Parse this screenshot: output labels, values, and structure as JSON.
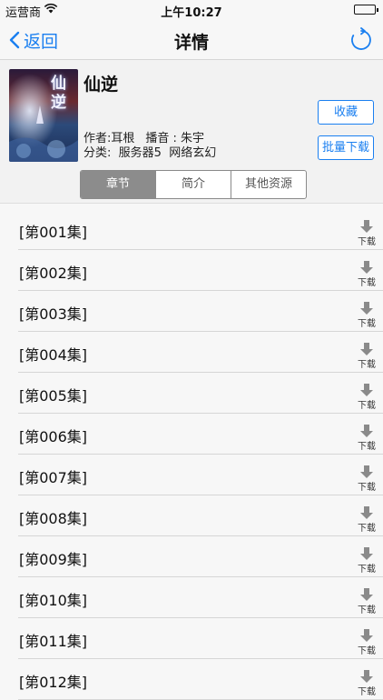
{
  "status_bar": {
    "carrier": "运营商",
    "time": "上午10:27"
  },
  "nav": {
    "back_label": "返回",
    "title": "详情"
  },
  "book": {
    "title": "仙逆",
    "author_line": "作者:耳根",
    "narrator_line": "播音 : 朱宇",
    "category_line": "分类:",
    "server": "服务器5",
    "genre": "网络玄幻",
    "cover_text": "仙逆"
  },
  "actions": {
    "favorite_label": "收藏",
    "batch_download_label": "批量下载"
  },
  "tabs": [
    {
      "label": "章节",
      "active": true
    },
    {
      "label": "简介",
      "active": false
    },
    {
      "label": "其他资源",
      "active": false
    }
  ],
  "chapters": [
    {
      "title": "[第001集]",
      "download_label": "下载"
    },
    {
      "title": "[第002集]",
      "download_label": "下载"
    },
    {
      "title": "[第003集]",
      "download_label": "下载"
    },
    {
      "title": "[第004集]",
      "download_label": "下载"
    },
    {
      "title": "[第005集]",
      "download_label": "下载"
    },
    {
      "title": "[第006集]",
      "download_label": "下载"
    },
    {
      "title": "[第007集]",
      "download_label": "下载"
    },
    {
      "title": "[第008集]",
      "download_label": "下载"
    },
    {
      "title": "[第009集]",
      "download_label": "下载"
    },
    {
      "title": "[第010集]",
      "download_label": "下载"
    },
    {
      "title": "[第011集]",
      "download_label": "下载"
    },
    {
      "title": "[第012集]",
      "download_label": "下载"
    }
  ],
  "colors": {
    "accent": "#1a7ff0",
    "segment_active": "#8c8c8c"
  }
}
